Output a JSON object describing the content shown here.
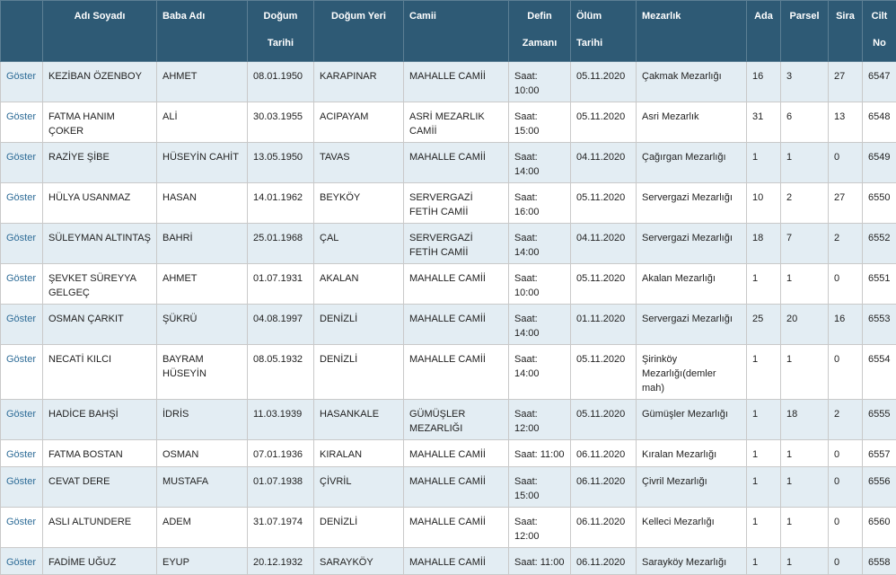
{
  "headers": {
    "name": "Adı Soyadı",
    "father": "Baba Adı",
    "birth_date_1": "Doğum",
    "birth_date_2": "Tarihi",
    "birth_place": "Doğum Yeri",
    "mosque": "Camii",
    "burial_1": "Defin",
    "burial_2": "Zamanı",
    "death_1": "Ölüm",
    "death_2": "Tarihi",
    "cemetery": "Mezarlık",
    "ada": "Ada",
    "parsel": "Parsel",
    "sira": "Sira",
    "cilt_1": "Cilt",
    "cilt_2": "No"
  },
  "rows": [
    {
      "link": "Göster",
      "name": "KEZİBAN ÖZENBOY",
      "father": "AHMET",
      "birth": "08.01.1950",
      "place": "KARAPINAR",
      "mosque": "MAHALLE CAMİİ",
      "burial": "Saat: 10:00",
      "death": "05.11.2020",
      "cemetery": "Çakmak Mezarlığı",
      "ada": "16",
      "parsel": "3",
      "sira": "27",
      "cilt": "6547"
    },
    {
      "link": "Göster",
      "name": "FATMA HANIM ÇOKER",
      "father": "ALİ",
      "birth": "30.03.1955",
      "place": "ACIPAYAM",
      "mosque": "ASRİ MEZARLIK CAMİİ",
      "burial": "Saat: 15:00",
      "death": "05.11.2020",
      "cemetery": "Asri Mezarlık",
      "ada": "31",
      "parsel": "6",
      "sira": "13",
      "cilt": "6548"
    },
    {
      "link": "Göster",
      "name": "RAZİYE ŞİBE",
      "father": "HÜSEYİN CAHİT",
      "birth": "13.05.1950",
      "place": "TAVAS",
      "mosque": "MAHALLE CAMİİ",
      "burial": "Saat: 14:00",
      "death": "04.11.2020",
      "cemetery": "Çağırgan Mezarlığı",
      "ada": "1",
      "parsel": "1",
      "sira": "0",
      "cilt": "6549"
    },
    {
      "link": "Göster",
      "name": "HÜLYA USANMAZ",
      "father": "HASAN",
      "birth": "14.01.1962",
      "place": "BEYKÖY",
      "mosque": "SERVERGAZİ FETİH CAMİİ",
      "burial": "Saat: 16:00",
      "death": "05.11.2020",
      "cemetery": "Servergazi Mezarlığı",
      "ada": "10",
      "parsel": "2",
      "sira": "27",
      "cilt": "6550"
    },
    {
      "link": "Göster",
      "name": "SÜLEYMAN ALTINTAŞ",
      "father": "BAHRİ",
      "birth": "25.01.1968",
      "place": "ÇAL",
      "mosque": "SERVERGAZİ FETİH CAMİİ",
      "burial": "Saat: 14:00",
      "death": "04.11.2020",
      "cemetery": "Servergazi Mezarlığı",
      "ada": "18",
      "parsel": "7",
      "sira": "2",
      "cilt": "6552"
    },
    {
      "link": "Göster",
      "name": "ŞEVKET SÜREYYA GELGEÇ",
      "father": "AHMET",
      "birth": "01.07.1931",
      "place": "AKALAN",
      "mosque": "MAHALLE CAMİİ",
      "burial": "Saat: 10:00",
      "death": "05.11.2020",
      "cemetery": "Akalan Mezarlığı",
      "ada": "1",
      "parsel": "1",
      "sira": "0",
      "cilt": "6551"
    },
    {
      "link": "Göster",
      "name": "OSMAN ÇARKIT",
      "father": "ŞÜKRÜ",
      "birth": "04.08.1997",
      "place": "DENİZLİ",
      "mosque": "MAHALLE CAMİİ",
      "burial": "Saat: 14:00",
      "death": "01.11.2020",
      "cemetery": "Servergazi Mezarlığı",
      "ada": "25",
      "parsel": "20",
      "sira": "16",
      "cilt": "6553"
    },
    {
      "link": "Göster",
      "name": "NECATİ KILCI",
      "father": "BAYRAM HÜSEYİN",
      "birth": "08.05.1932",
      "place": "DENİZLİ",
      "mosque": "MAHALLE CAMİİ",
      "burial": "Saat: 14:00",
      "death": "05.11.2020",
      "cemetery": "Şirinköy Mezarlığı(demler mah)",
      "ada": "1",
      "parsel": "1",
      "sira": "0",
      "cilt": "6554"
    },
    {
      "link": "Göster",
      "name": "HADİCE BAHŞİ",
      "father": "İDRİS",
      "birth": "11.03.1939",
      "place": "HASANKALE",
      "mosque": "GÜMÜŞLER MEZARLIĞI",
      "burial": "Saat: 12:00",
      "death": "05.11.2020",
      "cemetery": "Gümüşler Mezarlığı",
      "ada": "1",
      "parsel": "18",
      "sira": "2",
      "cilt": "6555"
    },
    {
      "link": "Göster",
      "name": "FATMA BOSTAN",
      "father": "OSMAN",
      "birth": "07.01.1936",
      "place": "KIRALAN",
      "mosque": "MAHALLE CAMİİ",
      "burial": "Saat: 11:00",
      "death": "06.11.2020",
      "cemetery": "Kıralan Mezarlığı",
      "ada": "1",
      "parsel": "1",
      "sira": "0",
      "cilt": "6557"
    },
    {
      "link": "Göster",
      "name": "CEVAT DERE",
      "father": "MUSTAFA",
      "birth": "01.07.1938",
      "place": "ÇİVRİL",
      "mosque": "MAHALLE CAMİİ",
      "burial": "Saat: 15:00",
      "death": "06.11.2020",
      "cemetery": "Çivril Mezarlığı",
      "ada": "1",
      "parsel": "1",
      "sira": "0",
      "cilt": "6556"
    },
    {
      "link": "Göster",
      "name": "ASLI ALTUNDERE",
      "father": "ADEM",
      "birth": "31.07.1974",
      "place": "DENİZLİ",
      "mosque": "MAHALLE CAMİİ",
      "burial": "Saat: 12:00",
      "death": "06.11.2020",
      "cemetery": "Kelleci Mezarlığı",
      "ada": "1",
      "parsel": "1",
      "sira": "0",
      "cilt": "6560"
    },
    {
      "link": "Göster",
      "name": "FADİME UĞUZ",
      "father": "EYUP",
      "birth": "20.12.1932",
      "place": "SARAYKÖY",
      "mosque": "MAHALLE CAMİİ",
      "burial": "Saat: 11:00",
      "death": "06.11.2020",
      "cemetery": "Sarayköy Mezarlığı",
      "ada": "1",
      "parsel": "1",
      "sira": "0",
      "cilt": "6558"
    }
  ]
}
